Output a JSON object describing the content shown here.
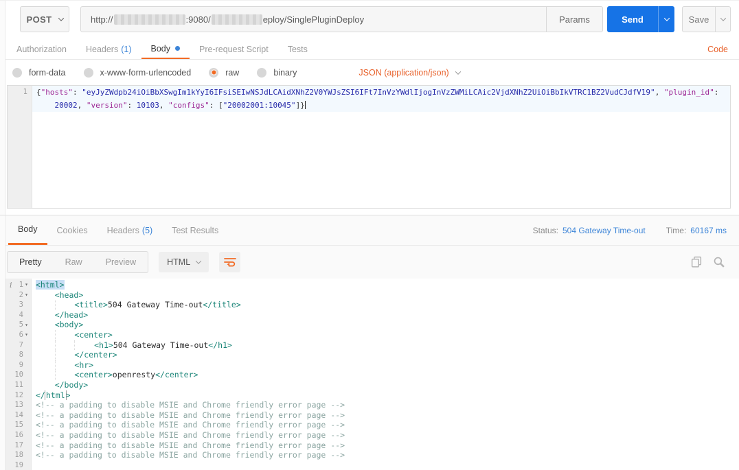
{
  "colors": {
    "accent_orange": "#f26b24",
    "link_blue": "#3d85d8",
    "send_blue": "#1673e6",
    "tag_teal": "#1b8578"
  },
  "request_bar": {
    "method": "POST",
    "url_segments": [
      {
        "type": "text",
        "text": "http://"
      },
      {
        "type": "redacted",
        "width": 104
      },
      {
        "type": "text",
        "text": ":9080/"
      },
      {
        "type": "redacted",
        "width": 74
      },
      {
        "type": "text",
        "text": "eploy/SinglePluginDeploy"
      }
    ],
    "params_label": "Params",
    "send_label": "Send",
    "save_label": "Save",
    "icons": {
      "method_dropdown": "chevron-down-icon",
      "send_dropdown": "chevron-down-icon",
      "save_dropdown": "chevron-down-icon"
    }
  },
  "request_tabs": {
    "items": [
      {
        "label": "Authorization",
        "active": false
      },
      {
        "label": "Headers",
        "count": "(1)",
        "active": false
      },
      {
        "label": "Body",
        "active": true,
        "dot": true
      },
      {
        "label": "Pre-request Script",
        "active": false
      },
      {
        "label": "Tests",
        "active": false
      }
    ],
    "code_link": "Code"
  },
  "body_type_bar": {
    "options": [
      {
        "label": "form-data",
        "selected": false
      },
      {
        "label": "x-www-form-urlencoded",
        "selected": false
      },
      {
        "label": "raw",
        "selected": true
      },
      {
        "label": "binary",
        "selected": false
      }
    ],
    "content_type": "JSON (application/json)",
    "content_type_icon": "chevron-down-icon"
  },
  "request_editor": {
    "rows": [
      {
        "number": "1",
        "indent": 0,
        "cursor": false,
        "active": true,
        "tokens": [
          {
            "c": "pun",
            "t": "{"
          },
          {
            "c": "key",
            "t": "\"hosts\""
          },
          {
            "c": "pun",
            "t": ": "
          },
          {
            "c": "str",
            "t": "\"eyJyZWdpb24iOiBbXSwgIm1kYyI6IFsiSEIwNSJdLCAidXNhZ2V0YWJsZSI6IFt7InVzYWdlIjogInVzZWMiLCAic2VjdXNhZ2UiOiBbIkVTRC1BZ2VudCJdfV19\""
          },
          {
            "c": "pun",
            "t": ", "
          },
          {
            "c": "key",
            "t": "\"plugin_id\""
          },
          {
            "c": "pun",
            "t": ":"
          }
        ]
      },
      {
        "number": "",
        "indent": 1,
        "cursor": true,
        "active": true,
        "tokens": [
          {
            "c": "num",
            "t": "20002"
          },
          {
            "c": "pun",
            "t": ", "
          },
          {
            "c": "key",
            "t": "\"version\""
          },
          {
            "c": "pun",
            "t": ": "
          },
          {
            "c": "num",
            "t": "10103"
          },
          {
            "c": "pun",
            "t": ", "
          },
          {
            "c": "key",
            "t": "\"configs\""
          },
          {
            "c": "pun",
            "t": ": ["
          },
          {
            "c": "str",
            "t": "\"20002001:10045\""
          },
          {
            "c": "pun",
            "t": "]}"
          }
        ]
      }
    ]
  },
  "response_meta": {
    "tabs": [
      {
        "label": "Body",
        "active": true
      },
      {
        "label": "Cookies",
        "active": false
      },
      {
        "label": "Headers",
        "count": "(5)",
        "active": false
      },
      {
        "label": "Test Results",
        "active": false
      }
    ],
    "status_label": "Status:",
    "status_value": "504 Gateway Time-out",
    "time_label": "Time:",
    "time_value": "60167 ms"
  },
  "response_toolbar": {
    "views": [
      {
        "label": "Pretty",
        "active": true
      },
      {
        "label": "Raw",
        "active": false
      },
      {
        "label": "Preview",
        "active": false
      }
    ],
    "format": "HTML",
    "icons": {
      "format_dropdown": "chevron-down-icon",
      "wrap": "word-wrap-icon",
      "copy": "copy-icon",
      "search": "search-icon",
      "info": "info-icon"
    }
  },
  "response_editor": {
    "info_icon_glyph": "i",
    "lines": [
      {
        "n": "1",
        "fold": true,
        "indent": 0,
        "tokens": [
          {
            "c": "tag sel",
            "t": "<html>"
          }
        ]
      },
      {
        "n": "2",
        "fold": true,
        "indent": 1,
        "tokens": [
          {
            "c": "tag",
            "t": "<head>"
          }
        ]
      },
      {
        "n": "3",
        "fold": false,
        "indent": 2,
        "tokens": [
          {
            "c": "tag",
            "t": "<title>"
          },
          {
            "c": "txt",
            "t": "504 Gateway Time-out"
          },
          {
            "c": "tag",
            "t": "</title>"
          }
        ]
      },
      {
        "n": "4",
        "fold": false,
        "indent": 1,
        "tokens": [
          {
            "c": "tag",
            "t": "</head>"
          }
        ]
      },
      {
        "n": "5",
        "fold": true,
        "indent": 1,
        "tokens": [
          {
            "c": "tag",
            "t": "<body>"
          }
        ]
      },
      {
        "n": "6",
        "fold": true,
        "indent": 2,
        "tokens": [
          {
            "c": "tag",
            "t": "<center>"
          }
        ]
      },
      {
        "n": "7",
        "fold": false,
        "indent": 3,
        "tokens": [
          {
            "c": "tag",
            "t": "<h1>"
          },
          {
            "c": "txt",
            "t": "504 Gateway Time-out"
          },
          {
            "c": "tag",
            "t": "</h1>"
          }
        ]
      },
      {
        "n": "8",
        "fold": false,
        "indent": 2,
        "tokens": [
          {
            "c": "tag",
            "t": "</center>"
          }
        ]
      },
      {
        "n": "9",
        "fold": false,
        "indent": 2,
        "tokens": [
          {
            "c": "tag",
            "t": "<hr>"
          }
        ]
      },
      {
        "n": "10",
        "fold": false,
        "indent": 2,
        "tokens": [
          {
            "c": "tag",
            "t": "<center>"
          },
          {
            "c": "txt",
            "t": "openresty"
          },
          {
            "c": "tag",
            "t": "</center>"
          }
        ]
      },
      {
        "n": "11",
        "fold": false,
        "indent": 1,
        "tokens": [
          {
            "c": "tag",
            "t": "</body>"
          }
        ]
      },
      {
        "n": "12",
        "fold": false,
        "indent": 0,
        "tokens": [
          {
            "c": "tag",
            "t": "</"
          },
          {
            "c": "tag box",
            "t": "html"
          },
          {
            "c": "tag",
            "t": ">"
          }
        ]
      },
      {
        "n": "13",
        "fold": false,
        "indent": 0,
        "tokens": [
          {
            "c": "com",
            "t": "<!-- a padding to disable MSIE and Chrome friendly error page -->"
          }
        ]
      },
      {
        "n": "14",
        "fold": false,
        "indent": 0,
        "tokens": [
          {
            "c": "com",
            "t": "<!-- a padding to disable MSIE and Chrome friendly error page -->"
          }
        ]
      },
      {
        "n": "15",
        "fold": false,
        "indent": 0,
        "tokens": [
          {
            "c": "com",
            "t": "<!-- a padding to disable MSIE and Chrome friendly error page -->"
          }
        ]
      },
      {
        "n": "16",
        "fold": false,
        "indent": 0,
        "tokens": [
          {
            "c": "com",
            "t": "<!-- a padding to disable MSIE and Chrome friendly error page -->"
          }
        ]
      },
      {
        "n": "17",
        "fold": false,
        "indent": 0,
        "tokens": [
          {
            "c": "com",
            "t": "<!-- a padding to disable MSIE and Chrome friendly error page -->"
          }
        ]
      },
      {
        "n": "18",
        "fold": false,
        "indent": 0,
        "tokens": [
          {
            "c": "com",
            "t": "<!-- a padding to disable MSIE and Chrome friendly error page -->"
          }
        ]
      },
      {
        "n": "19",
        "fold": false,
        "indent": 0,
        "tokens": []
      }
    ]
  }
}
